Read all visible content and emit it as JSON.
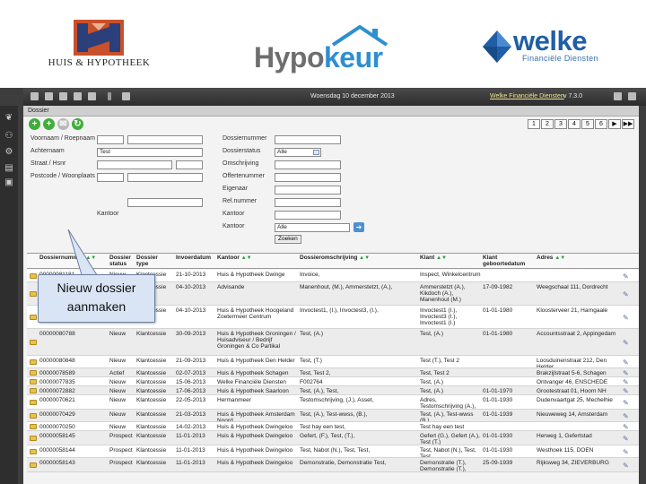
{
  "logos": {
    "huis_hypotheek": "HUIS & HYPOTHEEK",
    "hypokeur_part1": "Hypo",
    "hypokeur_part2": "keur",
    "welke": "welke",
    "welke_sub": "Financiële Diensten"
  },
  "topbar": {
    "date": "Woensdag 10 december 2013",
    "company": "Welke Financiële Diensten",
    "version": "v 7.3.0"
  },
  "panel": {
    "title": "Dossier",
    "pager": [
      "1",
      "2",
      "3",
      "4",
      "5",
      "6",
      "▶",
      "▶▶"
    ]
  },
  "form": {
    "labels": {
      "voornaam": "Voornaam / Roepnaam",
      "achternaam": "Achternaam",
      "straat": "Straat / Hsnr",
      "postcode": "Postcode / Woonplaats",
      "dossiernummer": "Dossiernummer",
      "dossierstatus": "Dossierstatus",
      "omschrijving": "Omschrijving",
      "offertenummer": "Offertenummer",
      "eigenaar": "Eigenaar",
      "rel_nummer": "Rel.nummer",
      "kantoor_adv": "Kantoor",
      "kantoor": "Kantoor"
    },
    "values": {
      "achternaam": "Test",
      "dossierstatus": "Alle",
      "kantoor": "Alle"
    },
    "search_button": "Zoeken"
  },
  "callout": {
    "line1": "Nieuw dossier",
    "line2": "aanmaken"
  },
  "table": {
    "headers": {
      "dossiernummer": "Dossiernummer",
      "status": "Dossier status",
      "type": "Dossier type",
      "invoerdatum": "Invoerdatum",
      "kantoor": "Kantoor",
      "omschrijving": "Dossieromschrijving",
      "klant": "Klant",
      "geboortedatum": "Klant geboortedatum",
      "adres": "Adres"
    },
    "rows": [
      {
        "nr": "00000081181",
        "status": "Nieuw",
        "type": "Klantcessie",
        "datum": "21-10-2013",
        "kantoor": "Huis & Hypotheek Dwinge",
        "omschr": "Invoice,",
        "klant": "Inspect, Winkelcentrum",
        "geb": "",
        "adres": ""
      },
      {
        "nr": "00000081255",
        "status": "Nieuw",
        "type": "Klantcessie",
        "datum": "04-10-2013",
        "kantoor": "Advisande",
        "omschr": "Manenhout, (M.), Ammerstetzt, (A.),",
        "klant": "Ammerstetzt (A.), Kikdoch (A.), Manenhout (M.)",
        "geb": "17-09-1982",
        "adres": "Weegschaal 111, Dordrecht"
      },
      {
        "nr": "00000081250",
        "status": "Nieuw",
        "type": "Klantcessie",
        "datum": "04-10-2013",
        "kantoor": "Huis & Hypotheek Hoogeland Zoetermeer Centrum",
        "omschr": "Invoctest1, (I.), Invoctest3, (I.),",
        "klant": "Invoctest1 (I.), Invoctest3 (I.), Invoctest1 (I.)",
        "geb": "01-01-1980",
        "adres": "Kloosterveer 21, Harngaale"
      },
      {
        "nr": "00000080788",
        "status": "Nieuw",
        "type": "Klantcessie",
        "datum": "30-09-2013",
        "kantoor": "Huis & Hypotheek Groningen / Huisadviseur / Bedrijf Groningen & Co Partikal",
        "omschr": "Test, (A.)",
        "klant": "Test, (A.)",
        "geb": "01-01-1980",
        "adres": "Accountsstraat 2, Appingedam"
      },
      {
        "nr": "00000080848",
        "status": "Nieuw",
        "type": "Klantcessie",
        "datum": "21-09-2013",
        "kantoor": "Huis & Hypotheek Den Helder",
        "omschr": "Test, (T.)",
        "klant": "Test (T.), Test 2",
        "geb": "",
        "adres": "Loosduinenstraat 212, Den Helder"
      },
      {
        "nr": "00000078589",
        "status": "Actief",
        "type": "Klantcessie",
        "datum": "02-07-2013",
        "kantoor": "Huis & Hypotheek Schagen",
        "omschr": "Test, Test 2,",
        "klant": "Test, Test 2",
        "geb": "",
        "adres": "Brakzijlstraat 5-6, Schagen"
      },
      {
        "nr": "00000077835",
        "status": "Nieuw",
        "type": "Klantcessie",
        "datum": "15-06-2013",
        "kantoor": "Welke Financiële Diensten",
        "omschr": "F002764",
        "klant": "Test, (A.)",
        "geb": "",
        "adres": "Ontvanger 46, ENSCHEDE"
      },
      {
        "nr": "00000072882",
        "status": "Nieuw",
        "type": "Klantcessie",
        "datum": "17-06-2013",
        "kantoor": "Huis & Hypotheek Saarloon",
        "omschr": "Test, (A.), Test,",
        "klant": "Test, (A.)",
        "geb": "01-01-1970",
        "adres": "Grootestraat 01, Hoorn NH"
      },
      {
        "nr": "00000070621",
        "status": "Nieuw",
        "type": "Klantcessie",
        "datum": "22-05-2013",
        "kantoor": "Hermanmeer",
        "omschr": "Testomschrijving, (J.), Asset,",
        "klant": "Adres, Testomschrijving (A.), (J.)",
        "geb": "01-01-1930",
        "adres": "Dudenvaartgat 25, Mechelhie"
      },
      {
        "nr": "00000070429",
        "status": "Nieuw",
        "type": "Klantcessie",
        "datum": "21-03-2013",
        "kantoor": "Huis & Hypotheek Amsterdam Noord",
        "omschr": "Test, (A.), Test-wwss, (B.),",
        "klant": "Test, (A.), Test-wwss (B.)",
        "geb": "01-01-1939",
        "adres": "Nieuweweg 14, Amsterdam"
      },
      {
        "nr": "00000070250",
        "status": "Nieuw",
        "type": "Klantcessie",
        "datum": "14-02-2013",
        "kantoor": "Huis & Hypotheek Dwingeloo",
        "omschr": "Test hay een test,",
        "klant": "Test hay een test",
        "geb": "",
        "adres": ""
      },
      {
        "nr": "00000058145",
        "status": "Prospect",
        "type": "Klantcessie",
        "datum": "11-01-2013",
        "kantoor": "Huis & Hypotheek Dwingeloo",
        "omschr": "Gefert, (F.), Test, (T.),",
        "klant": "Gefert (G.), Gefert (A.), Test (T.)",
        "geb": "01-01-1930",
        "adres": "Herweg 1, Gefertstad"
      },
      {
        "nr": "00000058144",
        "status": "Prospect",
        "type": "Klantcessie",
        "datum": "11-01-2013",
        "kantoor": "Huis & Hypotheek Dwingeloo",
        "omschr": "Test, Nabot (N.), Test, Test,",
        "klant": "Test, Nabot (N.), Test, Test",
        "geb": "01-01-1930",
        "adres": "Westhoek 115, DOEN"
      },
      {
        "nr": "00000058143",
        "status": "Prospect",
        "type": "Klantcessie",
        "datum": "11-01-2013",
        "kantoor": "Huis & Hypotheek Dwingeloo",
        "omschr": "Demonstratie, Demonstratie Test,",
        "klant": "Demonstratie (T.), Demonstratie (T.), Demonstratie test (T.)",
        "geb": "25-09-1939",
        "adres": "Rijksweg 34, ZIEVERBURG"
      }
    ]
  }
}
